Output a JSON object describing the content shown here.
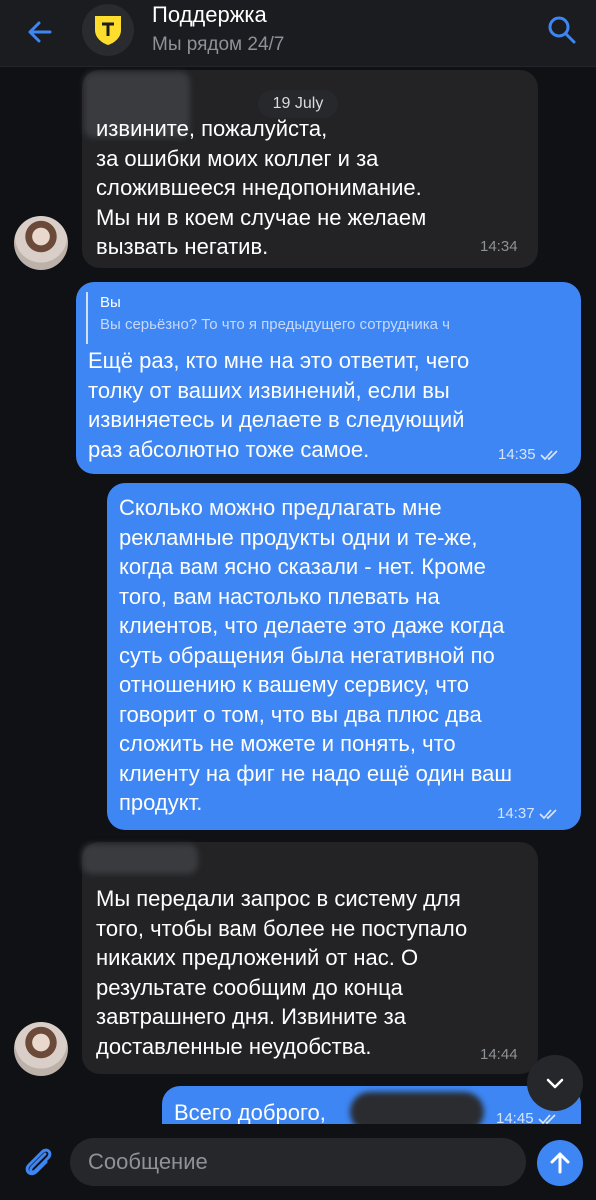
{
  "header": {
    "title": "Поддержка",
    "subtitle": "Мы рядом 24/7"
  },
  "date_label": "19 July",
  "messages": [
    {
      "direction": "incoming",
      "text": "извините, пожалуйста,\nза ошибки моих коллег и за\nсложившееся ннедопонимание.\nМы ни в коем случае не желаем\nвызвать негатив.",
      "time": "14:34"
    },
    {
      "direction": "outgoing",
      "reply": {
        "author": "Вы",
        "text": "Вы серьёзно? То что я предыдущего сотрудника ч"
      },
      "text": "Ещё раз, кто мне на это ответит, чего\nтолку от ваших извинений, если вы\nизвиняетесь и делаете в следующий\nраз абсолютно тоже самое.",
      "time": "14:35",
      "status": "read"
    },
    {
      "direction": "outgoing",
      "text": "Сколько можно предлагать мне\nрекламные продукты одни и те-же,\nкогда вам ясно сказали - нет. Кроме\nтого, вам настолько плевать на\nклиентов, что делаете это даже когда\nсуть обращения была негативной по\nотношению к вашему сервису, что\nговорит о том, что вы два плюс два\nсложить не можете и понять, что\nклиенту на фиг не надо ещё один ваш\nпродукт.",
      "time": "14:37",
      "status": "read"
    },
    {
      "direction": "incoming",
      "text": "Мы передали запрос в систему для\nтого, чтобы вам более не поступало\nникаких предложений от нас. О\nрезультате сообщим до конца\nзавтрашнего дня. Извините за\nдоставленные неудобства.",
      "time": "14:44"
    },
    {
      "direction": "outgoing",
      "text": "Всего доброго,",
      "time": "14:45",
      "status": "read"
    }
  ],
  "composer": {
    "placeholder": "Сообщение"
  },
  "icons": {
    "back": "arrow-left-icon",
    "search": "search-icon",
    "attach": "paperclip-icon",
    "send": "arrow-up-icon",
    "scroll_down": "chevron-down-icon",
    "read_status": "double-check-icon"
  },
  "colors": {
    "accent": "#3d86f4",
    "background": "#101114",
    "incoming_bubble": "#232326",
    "header": "#1b1c20"
  }
}
